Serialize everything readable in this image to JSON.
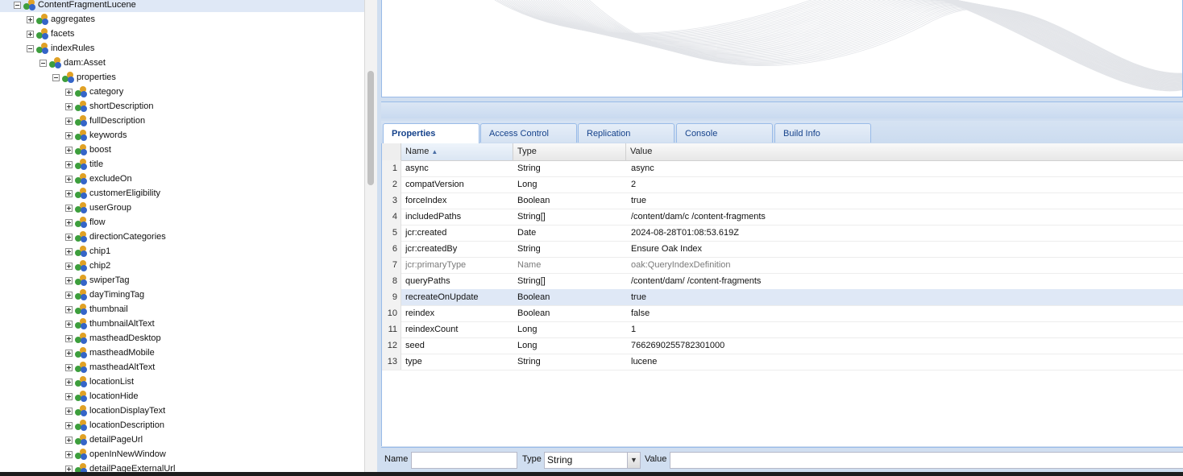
{
  "tree": {
    "nodes": [
      {
        "label": "ContentFragmentLucene",
        "level": 1,
        "toggle": "minus",
        "selected": true
      },
      {
        "label": "aggregates",
        "level": 2,
        "toggle": "plus"
      },
      {
        "label": "facets",
        "level": 2,
        "toggle": "plus"
      },
      {
        "label": "indexRules",
        "level": 2,
        "toggle": "minus"
      },
      {
        "label": "dam:Asset",
        "level": 3,
        "toggle": "minus"
      },
      {
        "label": "properties",
        "level": 4,
        "toggle": "minus"
      },
      {
        "label": "category",
        "level": 5,
        "toggle": "plus"
      },
      {
        "label": "shortDescription",
        "level": 5,
        "toggle": "plus"
      },
      {
        "label": "fullDescription",
        "level": 5,
        "toggle": "plus"
      },
      {
        "label": "keywords",
        "level": 5,
        "toggle": "plus"
      },
      {
        "label": "boost",
        "level": 5,
        "toggle": "plus"
      },
      {
        "label": "title",
        "level": 5,
        "toggle": "plus"
      },
      {
        "label": "excludeOn",
        "level": 5,
        "toggle": "plus"
      },
      {
        "label": "customerEligibility",
        "level": 5,
        "toggle": "plus"
      },
      {
        "label": "userGroup",
        "level": 5,
        "toggle": "plus"
      },
      {
        "label": "flow",
        "level": 5,
        "toggle": "plus"
      },
      {
        "label": "directionCategories",
        "level": 5,
        "toggle": "plus"
      },
      {
        "label": "chip1",
        "level": 5,
        "toggle": "plus"
      },
      {
        "label": "chip2",
        "level": 5,
        "toggle": "plus"
      },
      {
        "label": "swiperTag",
        "level": 5,
        "toggle": "plus"
      },
      {
        "label": "dayTimingTag",
        "level": 5,
        "toggle": "plus"
      },
      {
        "label": "thumbnail",
        "level": 5,
        "toggle": "plus"
      },
      {
        "label": "thumbnailAltText",
        "level": 5,
        "toggle": "plus"
      },
      {
        "label": "mastheadDesktop",
        "level": 5,
        "toggle": "plus"
      },
      {
        "label": "mastheadMobile",
        "level": 5,
        "toggle": "plus"
      },
      {
        "label": "mastheadAltText",
        "level": 5,
        "toggle": "plus"
      },
      {
        "label": "locationList",
        "level": 5,
        "toggle": "plus"
      },
      {
        "label": "locationHide",
        "level": 5,
        "toggle": "plus"
      },
      {
        "label": "locationDisplayText",
        "level": 5,
        "toggle": "plus"
      },
      {
        "label": "locationDescription",
        "level": 5,
        "toggle": "plus"
      },
      {
        "label": "detailPageUrl",
        "level": 5,
        "toggle": "plus"
      },
      {
        "label": "openInNewWindow",
        "level": 5,
        "toggle": "plus"
      },
      {
        "label": "detailPageExternalUrl",
        "level": 5,
        "toggle": "plus"
      }
    ]
  },
  "tabs": [
    {
      "label": "Properties",
      "active": true
    },
    {
      "label": "Access Control",
      "active": false
    },
    {
      "label": "Replication",
      "active": false
    },
    {
      "label": "Console",
      "active": false
    },
    {
      "label": "Build Info",
      "active": false
    }
  ],
  "grid": {
    "columns": {
      "name": "Name",
      "type": "Type",
      "value": "Value"
    },
    "sort_indicator": "▲",
    "rows": [
      {
        "num": "1",
        "name": "async",
        "type": "String",
        "value": "async"
      },
      {
        "num": "2",
        "name": "compatVersion",
        "type": "Long",
        "value": "2"
      },
      {
        "num": "3",
        "name": "forceIndex",
        "type": "Boolean",
        "value": "true"
      },
      {
        "num": "4",
        "name": "includedPaths",
        "type": "String[]",
        "value": "/content/dam/c  /content-fragments"
      },
      {
        "num": "5",
        "name": "jcr:created",
        "type": "Date",
        "value": "2024-08-28T01:08:53.619Z"
      },
      {
        "num": "6",
        "name": "jcr:createdBy",
        "type": "String",
        "value": "Ensure Oak Index"
      },
      {
        "num": "7",
        "name": "jcr:primaryType",
        "type": "Name",
        "value": "oak:QueryIndexDefinition",
        "dim": true
      },
      {
        "num": "8",
        "name": "queryPaths",
        "type": "String[]",
        "value": "/content/dam/  /content-fragments"
      },
      {
        "num": "9",
        "name": "recreateOnUpdate",
        "type": "Boolean",
        "value": "true",
        "selected": true
      },
      {
        "num": "10",
        "name": "reindex",
        "type": "Boolean",
        "value": "false"
      },
      {
        "num": "11",
        "name": "reindexCount",
        "type": "Long",
        "value": "1"
      },
      {
        "num": "12",
        "name": "seed",
        "type": "Long",
        "value": "7662690255782301000"
      },
      {
        "num": "13",
        "name": "type",
        "type": "String",
        "value": "lucene"
      }
    ]
  },
  "editor": {
    "name_label": "Name",
    "name_value": "",
    "type_label": "Type",
    "type_value": "String",
    "value_label": "Value",
    "value_value": ""
  },
  "colors": {
    "panel_bg": "#d0def0",
    "border": "#99bbe8",
    "tab_text": "#15428b",
    "selected_row": "#dfe8f6"
  }
}
